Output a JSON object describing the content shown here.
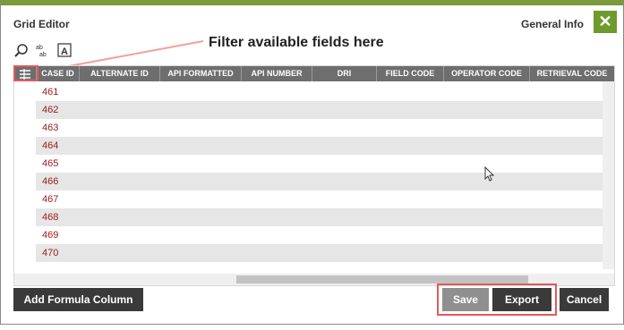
{
  "window": {
    "title": "Grid Editor",
    "right_title": "General Info",
    "close_label": "✕"
  },
  "toolbar": {
    "icons": [
      "search-icon",
      "ab-ab-icon",
      "a-box-icon"
    ]
  },
  "callout": {
    "text": "Filter available fields here"
  },
  "grid": {
    "columns": [
      "CASE ID",
      "ALTERNATE ID",
      "API FORMATTED",
      "API NUMBER",
      "DRI",
      "FIELD CODE",
      "OPERATOR CODE",
      "RETRIEVAL CODE"
    ],
    "rows": [
      "461",
      "462",
      "463",
      "464",
      "465",
      "466",
      "467",
      "468",
      "469",
      "470"
    ]
  },
  "footer": {
    "add_formula_label": "Add Formula Column",
    "save_label": "Save",
    "export_label": "Export",
    "cancel_label": "Cancel"
  },
  "colors": {
    "accent": "#7a9a3c",
    "close_bg": "#6f9a2c",
    "row_id_text": "#9a1a1a",
    "highlight": "#e45a5a",
    "dark_button": "#3a3a3a"
  }
}
